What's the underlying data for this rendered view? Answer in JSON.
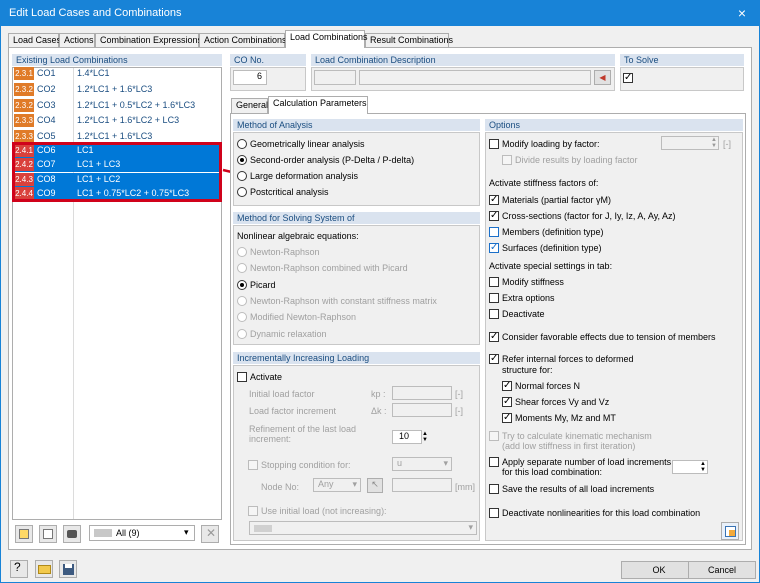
{
  "window": {
    "title": "Edit Load Cases and Combinations",
    "close_icon": "×"
  },
  "tabs": [
    "Load Cases",
    "Actions",
    "Combination Expressions",
    "Action Combinations",
    "Load Combinations",
    "Result Combinations"
  ],
  "left": {
    "header": "Existing Load Combinations",
    "rows": [
      {
        "badge": "2.3.1",
        "id": "CO1",
        "expr": "1.4*LC1",
        "color": "#e07b28",
        "selected": false
      },
      {
        "badge": "2.3.2",
        "id": "CO2",
        "expr": "1.2*LC1 + 1.6*LC3",
        "color": "#e07b28",
        "selected": false
      },
      {
        "badge": "2.3.2",
        "id": "CO3",
        "expr": "1.2*LC1 + 0.5*LC2 + 1.6*LC3",
        "color": "#e07b28",
        "selected": false
      },
      {
        "badge": "2.3.3",
        "id": "CO4",
        "expr": "1.2*LC1 + 1.6*LC2 + LC3",
        "color": "#e07b28",
        "selected": false
      },
      {
        "badge": "2.3.3",
        "id": "CO5",
        "expr": "1.2*LC1 + 1.6*LC3",
        "color": "#e07b28",
        "selected": false
      },
      {
        "badge": "2.4.1",
        "id": "CO6",
        "expr": "LC1",
        "color": "#d9413c",
        "selected": true
      },
      {
        "badge": "2.4.2",
        "id": "CO7",
        "expr": "LC1 + LC3",
        "color": "#d9413c",
        "selected": true
      },
      {
        "badge": "2.4.3",
        "id": "CO8",
        "expr": "LC1 + LC2",
        "color": "#d9413c",
        "selected": true
      },
      {
        "badge": "2.4.4",
        "id": "CO9",
        "expr": "LC1 + 0.75*LC2 + 0.75*LC3",
        "color": "#d9413c",
        "selected": true
      }
    ],
    "filter": "All (9)"
  },
  "co_no": {
    "label": "CO No.",
    "value": "6"
  },
  "description": {
    "label": "Load Combination Description",
    "value": ""
  },
  "to_solve": {
    "label": "To Solve",
    "checked": true
  },
  "subtabs": [
    "General",
    "Calculation Parameters"
  ],
  "method_analysis": {
    "title": "Method of Analysis",
    "options": [
      "Geometrically linear analysis",
      "Second-order analysis (P-Delta / P-delta)",
      "Large deformation analysis",
      "Postcritical analysis"
    ],
    "selected": 1
  },
  "method_solving": {
    "title": "Method for Solving System of",
    "subtitle": "Nonlinear algebraic equations:",
    "options": [
      "Newton-Raphson",
      "Newton-Raphson combined with Picard",
      "Picard",
      "Newton-Raphson with constant stiffness matrix",
      "Modified Newton-Raphson",
      "Dynamic relaxation"
    ],
    "selected": 2
  },
  "incremental": {
    "title": "Incrementally Increasing Loading",
    "activate": "Activate",
    "initial_load_factor": "Initial load factor",
    "kp": "kp :",
    "load_factor_increment": "Load factor increment",
    "dk": "Δk :",
    "unit_dash": "[-]",
    "refinement_1": "Refinement of the last load",
    "refinement_2": "increment:",
    "refinement_value": "10",
    "stopping": "Stopping condition for:",
    "stopping_value": "u",
    "node_no": "Node No:",
    "node_value": "Any",
    "unit_mm": "[mm]",
    "use_initial": "Use initial load (not increasing):"
  },
  "options": {
    "title": "Options",
    "modify_loading": "Modify loading by factor:",
    "modify_unit": "[-]",
    "divide_results": "Divide results by loading factor",
    "activate_stiffness_title": "Activate stiffness factors of:",
    "materials": "Materials (partial factor γM)",
    "cross_sections": "Cross-sections (factor for J, Iy, Iz, A, Ay, Az)",
    "members": "Members (definition type)",
    "surfaces": "Surfaces (definition type)",
    "special_title": "Activate special settings in tab:",
    "modify_stiffness": "Modify stiffness",
    "extra_options": "Extra options",
    "deactivate": "Deactivate",
    "favorable": "Consider favorable effects due to tension of members",
    "refer_1": "Refer internal forces to deformed",
    "refer_2": "structure for:",
    "normal_forces": "Normal forces N",
    "shear_forces": "Shear forces Vy and Vz",
    "moments": "Moments My, Mz and MT",
    "kinematic_1": "Try to calculate kinematic mechanism",
    "kinematic_2": "(add low stiffness in first iteration)",
    "apply_sep_1": "Apply separate number of load increments",
    "apply_sep_2": "for this load combination:",
    "save_results": "Save the results of all load increments",
    "deactivate_nonlinear": "Deactivate nonlinearities for this load combination"
  },
  "footer": {
    "ok": "OK",
    "cancel": "Cancel"
  },
  "colors": {
    "title_blue": "#1883d7",
    "selection": "#0078d7",
    "highlight_red": "#d0021b"
  }
}
